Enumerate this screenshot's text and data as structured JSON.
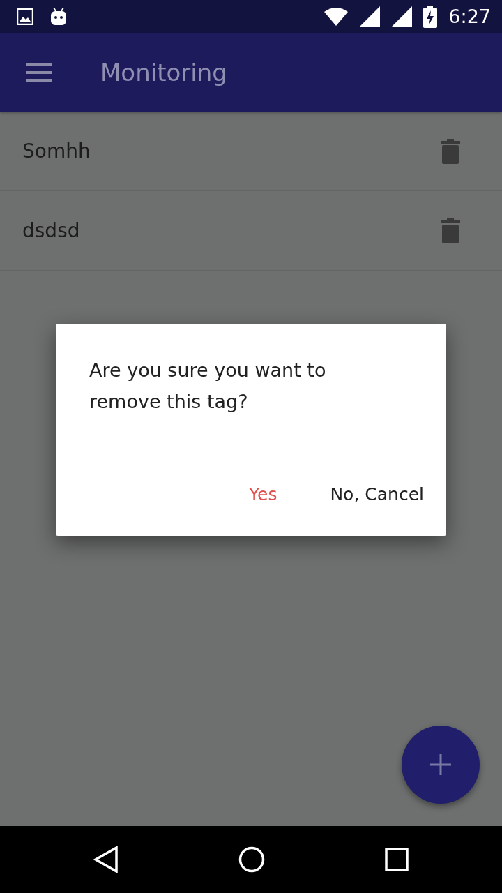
{
  "status_bar": {
    "time": "6:27"
  },
  "app_bar": {
    "title": "Monitoring"
  },
  "tags": [
    {
      "name": "Somhh"
    },
    {
      "name": "dsdsd"
    }
  ],
  "dialog": {
    "message": "Are you sure you want to remove this tag?",
    "buttons": [
      {
        "label": "Yes",
        "kind": "destructive"
      },
      {
        "label": "No, Cancel",
        "kind": "neutral"
      }
    ]
  }
}
